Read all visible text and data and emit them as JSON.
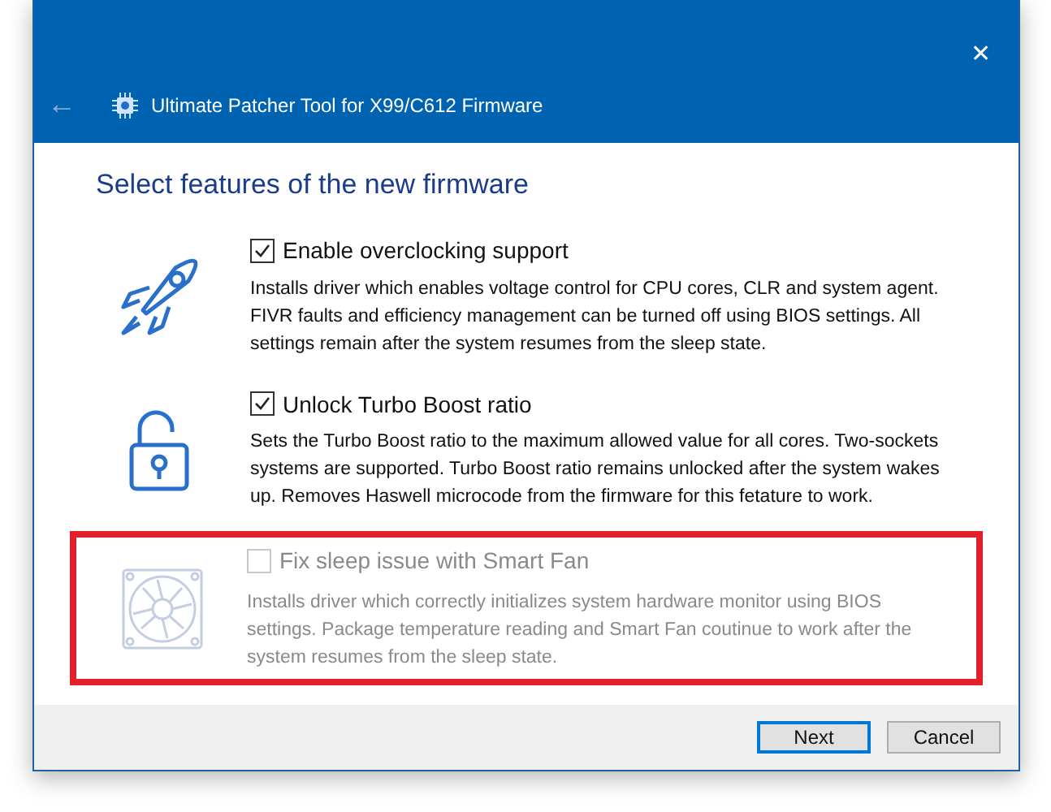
{
  "window": {
    "title": "Ultimate Patcher Tool for X99/C612 Firmware",
    "close": "✕",
    "back": "←"
  },
  "heading": "Select features of the new firmware",
  "features": [
    {
      "kind": "rocket",
      "label": "Enable overclocking support",
      "checked": true,
      "disabled": false,
      "highlighted": false,
      "description": "Installs driver which enables voltage control for CPU cores, CLR and system agent. FIVR faults and efficiency management can be turned off using BIOS settings. All settings remain after the system resumes from the sleep state."
    },
    {
      "kind": "lock",
      "label": "Unlock Turbo Boost ratio",
      "checked": true,
      "disabled": false,
      "highlighted": false,
      "description": "Sets the Turbo Boost ratio to the maximum allowed value for all cores. Two-sockets systems are supported. Turbo Boost ratio remains unlocked after the system wakes up. Removes Haswell microcode from the firmware for this fetature to work."
    },
    {
      "kind": "fan",
      "label": "Fix sleep issue with Smart Fan",
      "checked": false,
      "disabled": true,
      "highlighted": true,
      "description": "Installs driver which correctly initializes system hardware monitor using BIOS settings. Package temperature reading and Smart Fan coutinue to work after the system resumes from the sleep state."
    }
  ],
  "buttons": [
    {
      "label": "Next",
      "default": true
    },
    {
      "label": "Cancel",
      "default": false
    }
  ]
}
